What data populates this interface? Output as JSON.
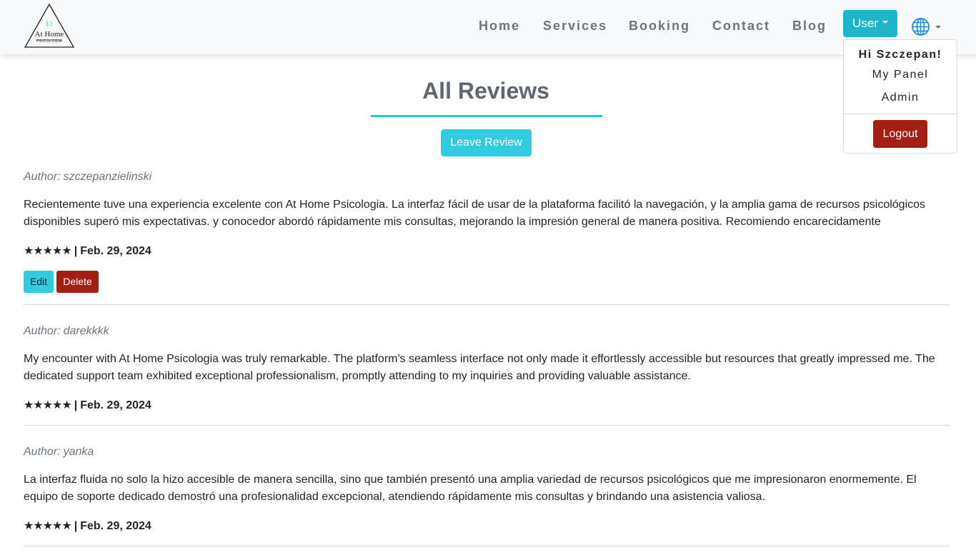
{
  "logo": {
    "title": "At Home",
    "subtitle": "PSICOLOGIA"
  },
  "nav": {
    "links": [
      "Home",
      "Services",
      "Booking",
      "Contact",
      "Blog"
    ],
    "user_button": "User",
    "language_icon": "globe-icon"
  },
  "user_menu": {
    "greeting": "Hi Szczepan!",
    "items": [
      "My Panel",
      "Admin"
    ],
    "logout": "Logout"
  },
  "main": {
    "title": "All Reviews",
    "leave_review": "Leave Review",
    "author_label": "Author:",
    "edit_label": "Edit",
    "delete_label": "Delete"
  },
  "colors": {
    "accent": "#31cbe0",
    "danger": "#a41f13",
    "nav_text": "#6c757d"
  },
  "reviews": [
    {
      "author": "szczepanzielinski",
      "text": "Recientemente tuve una experiencia excelente con At Home Psicologia. La interfaz fácil de usar de la plataforma facilitó la navegación, y la amplia gama de recursos psicológicos disponibles superó mis expectativas. y conocedor abordó rápidamente mis consultas, mejorando la impresión general de manera positiva. Recomiendo encarecidamente",
      "stars": "★★★★★",
      "rating": 5,
      "date": "Feb. 29, 2024"
    },
    {
      "author": "darekkkk",
      "text": "My encounter with At Home Psicologia was truly remarkable. The platform's seamless interface not only made it effortlessly accessible but resources that greatly impressed me. The dedicated support team exhibited exceptional professionalism, promptly attending to my inquiries and providing valuable assistance.",
      "stars": "★★★★★",
      "rating": 5,
      "date": "Feb. 29, 2024"
    },
    {
      "author": "yanka",
      "text": "La interfaz fluida no solo la hizo accesible de manera sencilla, sino que también presentó una amplia variedad de recursos psicológicos que me impresionaron enormemente. El equipo de soporte dedicado demostró una profesionalidad excepcional, atendiendo rápidamente mis consultas y brindando una asistencia valiosa.",
      "stars": "★★★★★",
      "rating": 5,
      "date": "Feb. 29, 2024"
    }
  ]
}
